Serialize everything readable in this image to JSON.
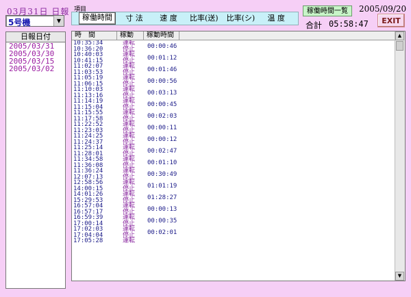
{
  "header": {
    "report_title": "03月31日 日報",
    "machine": "5号機",
    "section_label": "項目",
    "tabs": [
      "稼働時間",
      "寸 法",
      "速 度",
      "比率(送)",
      "比率(シ)",
      "温 度"
    ],
    "list_button": "稼働時間一覧",
    "current_date": "2005/09/20",
    "total_label": "合計",
    "total_value": "05:58:47",
    "exit_button": "EXIT"
  },
  "dates": {
    "header": "日報日付",
    "items": [
      "2005/03/31",
      "2005/03/30",
      "2005/03/15",
      "2005/03/02"
    ]
  },
  "grid": {
    "columns": [
      "時　間",
      "稼動",
      "稼動時間"
    ],
    "rows": [
      {
        "time": "10:35:34",
        "state": "運転",
        "dur": ""
      },
      {
        "time": "10:36:20",
        "state": "停止",
        "dur": "00:00:46"
      },
      {
        "time": "10:40:03",
        "state": "運転",
        "dur": ""
      },
      {
        "time": "10:41:15",
        "state": "停止",
        "dur": "00:01:12"
      },
      {
        "time": "11:02:07",
        "state": "運転",
        "dur": ""
      },
      {
        "time": "11:03:53",
        "state": "停止",
        "dur": "00:01:46"
      },
      {
        "time": "11:05:19",
        "state": "運転",
        "dur": ""
      },
      {
        "time": "11:06:15",
        "state": "停止",
        "dur": "00:00:56"
      },
      {
        "time": "11:10:03",
        "state": "運転",
        "dur": ""
      },
      {
        "time": "11:13:16",
        "state": "停止",
        "dur": "00:03:13"
      },
      {
        "time": "11:14:19",
        "state": "運転",
        "dur": ""
      },
      {
        "time": "11:15:04",
        "state": "停止",
        "dur": "00:00:45"
      },
      {
        "time": "11:15:55",
        "state": "運転",
        "dur": ""
      },
      {
        "time": "11:17:58",
        "state": "停止",
        "dur": "00:02:03"
      },
      {
        "time": "11:22:52",
        "state": "運転",
        "dur": ""
      },
      {
        "time": "11:23:03",
        "state": "停止",
        "dur": "00:00:11"
      },
      {
        "time": "11:24:25",
        "state": "運転",
        "dur": ""
      },
      {
        "time": "11:24:37",
        "state": "停止",
        "dur": "00:00:12"
      },
      {
        "time": "11:25:14",
        "state": "運転",
        "dur": ""
      },
      {
        "time": "11:28:01",
        "state": "停止",
        "dur": "00:02:47"
      },
      {
        "time": "11:34:58",
        "state": "運転",
        "dur": ""
      },
      {
        "time": "11:36:08",
        "state": "停止",
        "dur": "00:01:10"
      },
      {
        "time": "11:36:24",
        "state": "運転",
        "dur": ""
      },
      {
        "time": "12:07:13",
        "state": "停止",
        "dur": "00:30:49"
      },
      {
        "time": "12:58:56",
        "state": "運転",
        "dur": ""
      },
      {
        "time": "14:00:15",
        "state": "停止",
        "dur": "01:01:19"
      },
      {
        "time": "14:01:26",
        "state": "運転",
        "dur": ""
      },
      {
        "time": "15:29:53",
        "state": "停止",
        "dur": "01:28:27"
      },
      {
        "time": "16:57:04",
        "state": "運転",
        "dur": ""
      },
      {
        "time": "16:57:17",
        "state": "停止",
        "dur": "00:00:13"
      },
      {
        "time": "16:59:39",
        "state": "運転",
        "dur": ""
      },
      {
        "time": "17:00:14",
        "state": "停止",
        "dur": "00:00:35"
      },
      {
        "time": "17:02:03",
        "state": "運転",
        "dur": ""
      },
      {
        "time": "17:04:04",
        "state": "停止",
        "dur": "00:02:01"
      },
      {
        "time": "17:05:28",
        "state": "運転",
        "dur": ""
      }
    ]
  }
}
